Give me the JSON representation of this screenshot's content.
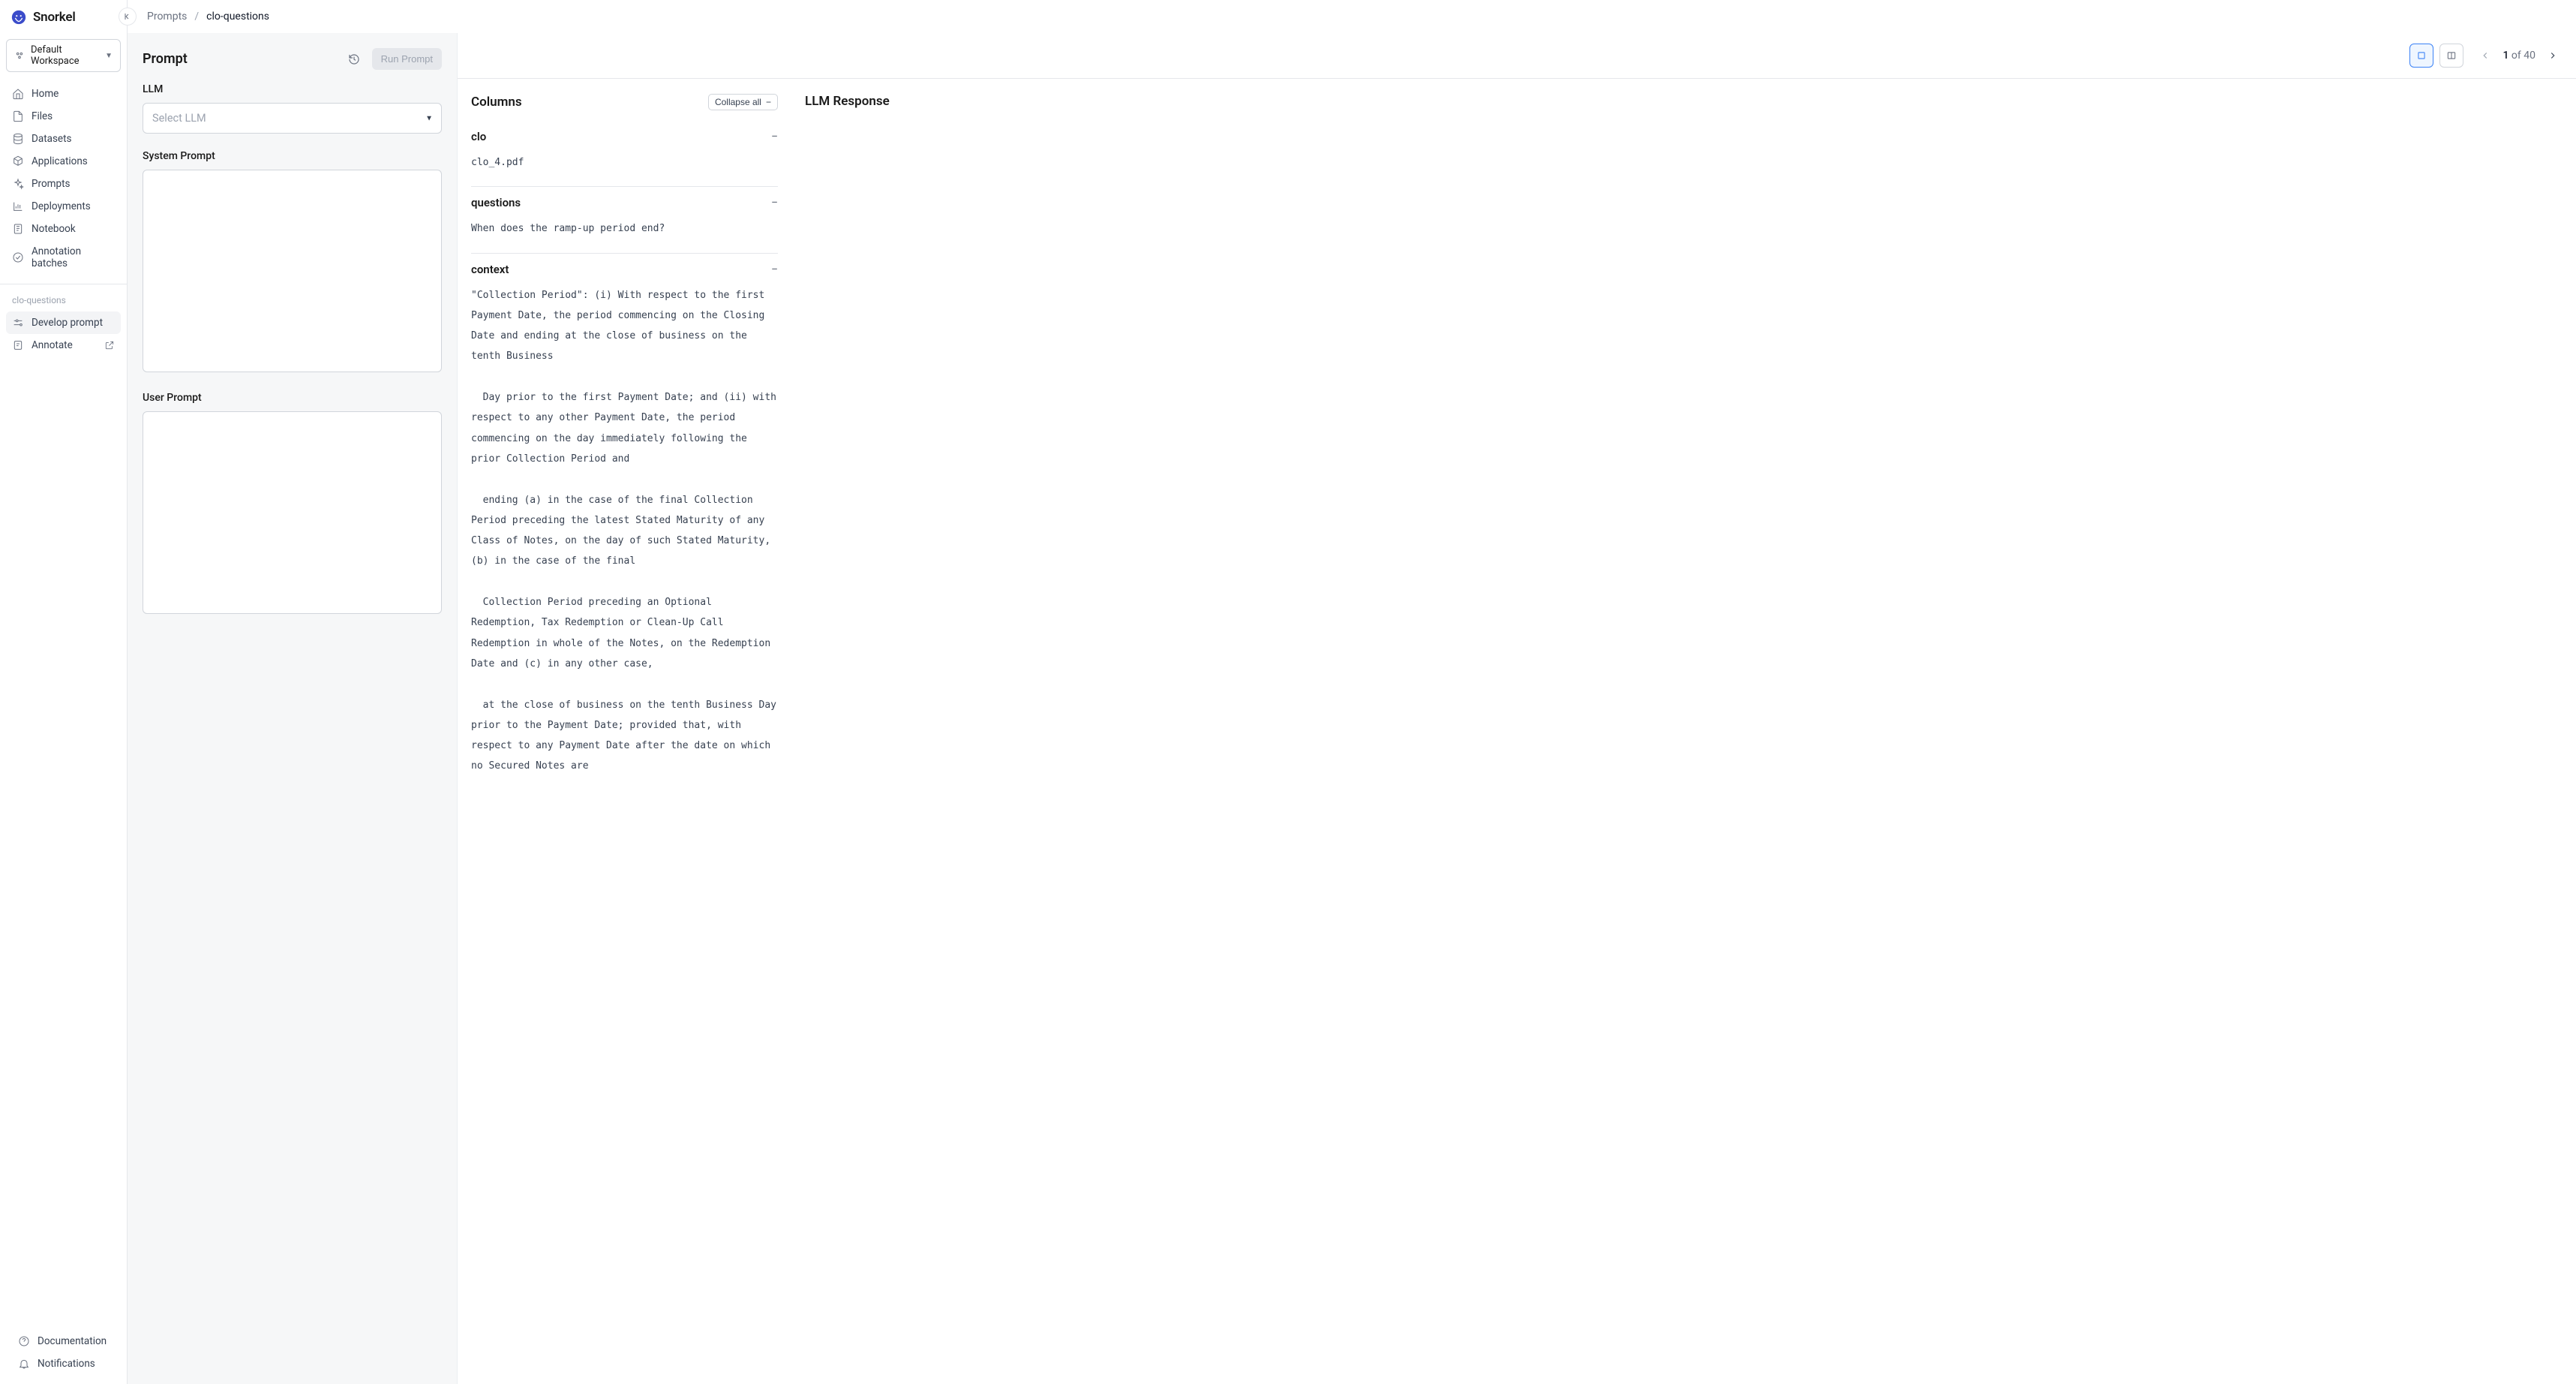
{
  "brand": "Snorkel",
  "workspace": {
    "label": "Default Workspace"
  },
  "nav": {
    "home": "Home",
    "files": "Files",
    "datasets": "Datasets",
    "applications": "Applications",
    "prompts": "Prompts",
    "deployments": "Deployments",
    "notebook": "Notebook",
    "annotation_batches": "Annotation batches"
  },
  "section": {
    "label": "clo-questions",
    "develop_prompt": "Develop prompt",
    "annotate": "Annotate"
  },
  "footer": {
    "documentation": "Documentation",
    "notifications": "Notifications"
  },
  "breadcrumb": {
    "root": "Prompts",
    "current": "clo-questions"
  },
  "prompt_panel": {
    "title": "Prompt",
    "run_label": "Run Prompt",
    "llm_label": "LLM",
    "llm_placeholder": "Select LLM",
    "system_label": "System Prompt",
    "user_label": "User Prompt"
  },
  "data_panel": {
    "page_current": "1",
    "page_of": "of",
    "page_total": "40",
    "columns_title": "Columns",
    "collapse_all": "Collapse all",
    "llm_title": "LLM Response",
    "columns": {
      "clo": {
        "name": "clo",
        "content": "clo_4.pdf"
      },
      "questions": {
        "name": "questions",
        "content": "When does the ramp-up period end?"
      },
      "context": {
        "name": "context",
        "content": "\"Collection Period\": (i) With respect to the first Payment Date, the period commencing on the Closing Date and ending at the close of business on the tenth Business\n\n  Day prior to the first Payment Date; and (ii) with respect to any other Payment Date, the period commencing on the day immediately following the prior Collection Period and\n\n  ending (a) in the case of the final Collection Period preceding the latest Stated Maturity of any Class of Notes, on the day of such Stated Maturity, (b) in the case of the final\n\n  Collection Period preceding an Optional Redemption, Tax Redemption or Clean-Up Call Redemption in whole of the Notes, on the Redemption Date and (c) in any other case,\n\n  at the close of business on the tenth Business Day prior to the Payment Date; provided that, with respect to any Payment Date after the date on which no Secured Notes are"
      }
    }
  }
}
